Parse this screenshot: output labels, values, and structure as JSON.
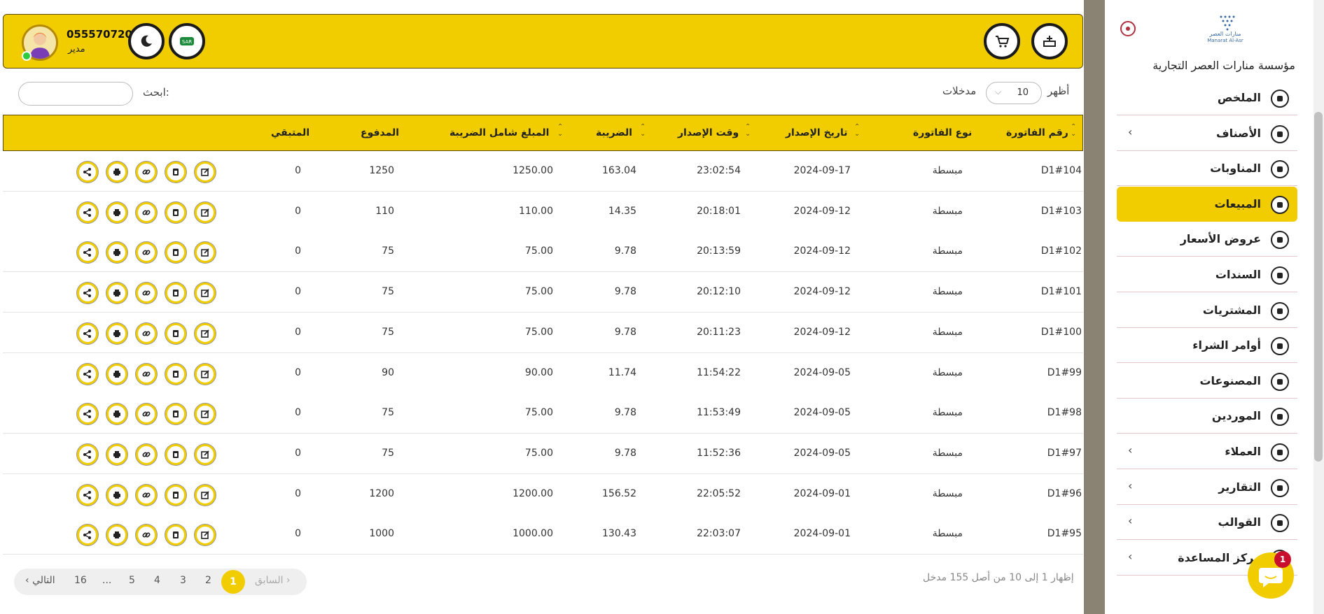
{
  "user": {
    "phone": "0555707200",
    "role": "مدير"
  },
  "brand": {
    "name": "مؤسسة منارات العصر التجارية",
    "logo_text": "منارات العصر",
    "logo_sub": "Manarat Al-Asr"
  },
  "controls": {
    "show_label": "أظهر",
    "entries_value": "10",
    "entries_label": "مدخلات",
    "search_label": "ابحث:",
    "search_value": ""
  },
  "table": {
    "headers": {
      "invoice_no": "رقم الفاتورة",
      "invoice_type": "نوع الفاتورة",
      "issue_date": "تاريخ الإصدار",
      "issue_time": "وقت الإصدار",
      "tax": "الضريبة",
      "total_with_tax": "المبلغ شامل الضريبة",
      "paid": "المدفوع",
      "remaining": "المتبقي"
    },
    "rows": [
      {
        "no": "D1#104",
        "type": "مبسطة",
        "date": "2024-09-17",
        "time": "23:02:54",
        "tax": "163.04",
        "total": "1250.00",
        "paid": "1250",
        "rem": "0"
      },
      {
        "no": "D1#103",
        "type": "مبسطة",
        "date": "2024-09-12",
        "time": "20:18:01",
        "tax": "14.35",
        "total": "110.00",
        "paid": "110",
        "rem": "0"
      },
      {
        "no": "D1#102",
        "type": "مبسطة",
        "date": "2024-09-12",
        "time": "20:13:59",
        "tax": "9.78",
        "total": "75.00",
        "paid": "75",
        "rem": "0"
      },
      {
        "no": "D1#101",
        "type": "مبسطة",
        "date": "2024-09-12",
        "time": "20:12:10",
        "tax": "9.78",
        "total": "75.00",
        "paid": "75",
        "rem": "0"
      },
      {
        "no": "D1#100",
        "type": "مبسطة",
        "date": "2024-09-12",
        "time": "20:11:23",
        "tax": "9.78",
        "total": "75.00",
        "paid": "75",
        "rem": "0"
      },
      {
        "no": "D1#99",
        "type": "مبسطة",
        "date": "2024-09-05",
        "time": "11:54:22",
        "tax": "11.74",
        "total": "90.00",
        "paid": "90",
        "rem": "0"
      },
      {
        "no": "D1#98",
        "type": "مبسطة",
        "date": "2024-09-05",
        "time": "11:53:49",
        "tax": "9.78",
        "total": "75.00",
        "paid": "75",
        "rem": "0"
      },
      {
        "no": "D1#97",
        "type": "مبسطة",
        "date": "2024-09-05",
        "time": "11:52:36",
        "tax": "9.78",
        "total": "75.00",
        "paid": "75",
        "rem": "0"
      },
      {
        "no": "D1#96",
        "type": "مبسطة",
        "date": "2024-09-01",
        "time": "22:05:52",
        "tax": "156.52",
        "total": "1200.00",
        "paid": "1200",
        "rem": "0"
      },
      {
        "no": "D1#95",
        "type": "مبسطة",
        "date": "2024-09-01",
        "time": "22:03:07",
        "tax": "130.43",
        "total": "1000.00",
        "paid": "1000",
        "rem": "0"
      }
    ],
    "row_actions": [
      "edit-icon",
      "copy-icon",
      "link-icon",
      "print-icon",
      "share-icon"
    ]
  },
  "footer": {
    "summary": "إظهار 1 إلى 10 من أصل 155 مدخل",
    "prev": "السابق",
    "next": "التالي",
    "pages": [
      "1",
      "2",
      "3",
      "4",
      "5",
      "...",
      "16"
    ],
    "current_page": "1"
  },
  "sidebar": {
    "items": [
      {
        "label": "الملخص",
        "icon": "bulb-icon",
        "arrow": false,
        "active": false
      },
      {
        "label": "الأصناف",
        "icon": "pie-icon",
        "arrow": true,
        "active": false
      },
      {
        "label": "المناوبات",
        "icon": "user-clock-icon",
        "arrow": false,
        "active": false
      },
      {
        "label": "المبيعات",
        "icon": "chart-icon",
        "arrow": false,
        "active": true
      },
      {
        "label": "عروض الأسعار",
        "icon": "quote-icon",
        "arrow": false,
        "active": false
      },
      {
        "label": "السندات",
        "icon": "receipt-icon",
        "arrow": false,
        "active": false
      },
      {
        "label": "المشتريات",
        "icon": "dollar-icon",
        "arrow": false,
        "active": false
      },
      {
        "label": "أوامر الشراء",
        "icon": "order-icon",
        "arrow": false,
        "active": false
      },
      {
        "label": "المصنوعات",
        "icon": "box-icon",
        "arrow": false,
        "active": false
      },
      {
        "label": "الموردين",
        "icon": "download-icon",
        "arrow": false,
        "active": false
      },
      {
        "label": "العملاء",
        "icon": "user-icon",
        "arrow": true,
        "active": false
      },
      {
        "label": "التقارير",
        "icon": "pen-icon",
        "arrow": true,
        "active": false
      },
      {
        "label": "القوالب",
        "icon": "template-icon",
        "arrow": true,
        "active": false
      },
      {
        "label": "مركز المساعدة",
        "icon": "help-icon",
        "arrow": true,
        "active": false
      }
    ]
  },
  "chat": {
    "badge": "1"
  },
  "colors": {
    "accent": "#f1cd00",
    "dark": "#222222",
    "badge": "#c8102e"
  }
}
